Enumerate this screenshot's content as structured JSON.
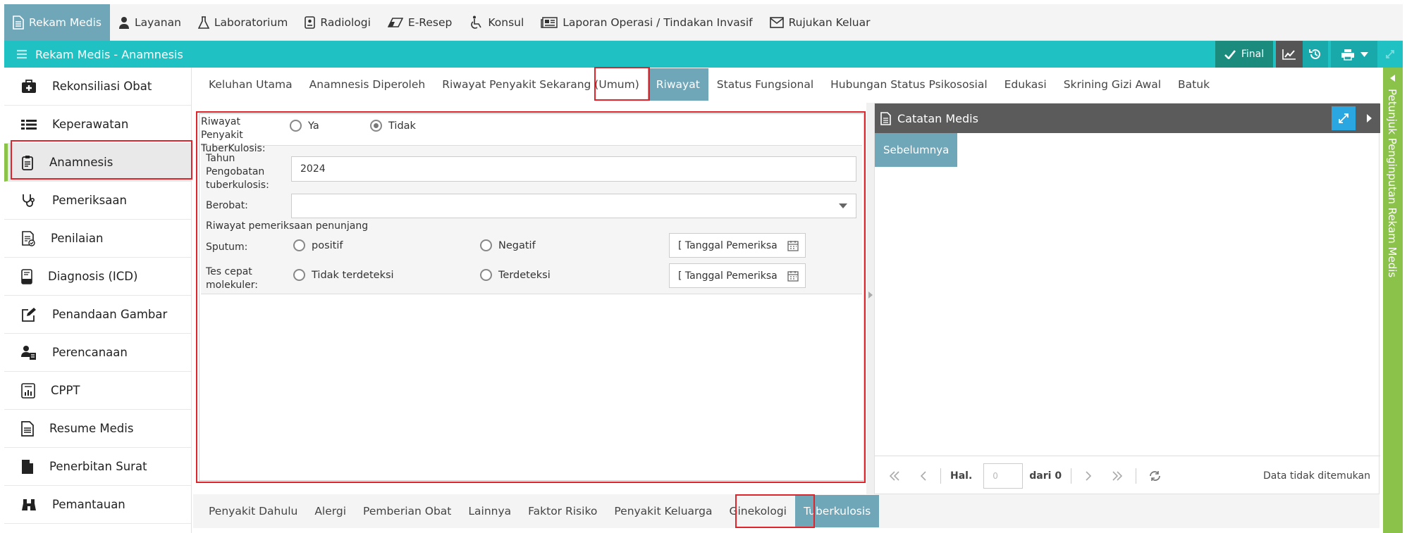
{
  "top_nav": [
    {
      "label": "Rekam Medis",
      "icon": "document-icon",
      "active": true
    },
    {
      "label": "Layanan",
      "icon": "doctor-icon"
    },
    {
      "label": "Laboratorium",
      "icon": "flask-icon"
    },
    {
      "label": "Radiologi",
      "icon": "xray-icon"
    },
    {
      "label": "E-Resep",
      "icon": "eraser-icon"
    },
    {
      "label": "Konsul",
      "icon": "wheelchair-icon"
    },
    {
      "label": "Laporan Operasi / Tindakan Invasif",
      "icon": "newspaper-icon"
    },
    {
      "label": "Rujukan Keluar",
      "icon": "envelope-icon"
    }
  ],
  "header": {
    "title": "Rekam Medis - Anamnesis",
    "final_label": "Final"
  },
  "sidebar": [
    {
      "label": "Rekonsiliasi Obat",
      "icon": "medkit-icon"
    },
    {
      "label": "Keperawatan",
      "icon": "list-icon"
    },
    {
      "label": "Anamnesis",
      "icon": "clipboard-icon",
      "active": true
    },
    {
      "label": "Pemeriksaan",
      "icon": "stethoscope-icon"
    },
    {
      "label": "Penilaian",
      "icon": "checklist-icon"
    },
    {
      "label": "Diagnosis (ICD)",
      "icon": "phone-doc-icon"
    },
    {
      "label": "Penandaan Gambar",
      "icon": "edit-icon"
    },
    {
      "label": "Perencanaan",
      "icon": "user-plan-icon"
    },
    {
      "label": "CPPT",
      "icon": "chart-doc-icon"
    },
    {
      "label": "Resume Medis",
      "icon": "file-text-icon"
    },
    {
      "label": "Penerbitan Surat",
      "icon": "file-icon"
    },
    {
      "label": "Pemantauan",
      "icon": "binoculars-icon"
    }
  ],
  "tabs": [
    "Keluhan Utama",
    "Anamnesis Diperoleh",
    "Riwayat Penyakit Sekarang (Umum)",
    "Riwayat",
    "Status Fungsional",
    "Hubungan Status Psikososial",
    "Edukasi",
    "Skrining Gizi Awal",
    "Batuk"
  ],
  "active_tab": "Riwayat",
  "form": {
    "riwayat_label": "Riwayat Penyakit TuberKulosis:",
    "opt_ya": "Ya",
    "opt_tidak": "Tidak",
    "selected": "Tidak",
    "tahun_label": "Tahun Pengobatan tuberkulosis:",
    "tahun_value": "2024",
    "berobat_label": "Berobat:",
    "berobat_value": "",
    "penunjang_label": "Riwayat pemeriksaan penunjang",
    "sputum_label": "Sputum:",
    "sputum_opt1": "positif",
    "sputum_opt2": "Negatif",
    "date_placeholder": "[ Tanggal Pemeriksa",
    "tcm_label": "Tes cepat molekuler:",
    "tcm_opt1": "Tidak terdeteksi",
    "tcm_opt2": "Terdeteksi"
  },
  "right_panel": {
    "title": "Catatan Medis",
    "tab": "Sebelumnya",
    "hal_label": "Hal.",
    "page_value": "0",
    "dari_label": "dari 0",
    "empty_label": "Data tidak ditemukan"
  },
  "bottom_tabs": [
    "Penyakit Dahulu",
    "Alergi",
    "Pemberian Obat",
    "Lainnya",
    "Faktor Risiko",
    "Penyakit Keluarga",
    "Ginekologi",
    "Tuberkulosis"
  ],
  "active_bottom_tab": "Tuberkulosis",
  "side_handle": "Petunjuk Penginputan Rekam Medis",
  "colors": {
    "teal": "#1fc1c3",
    "active_tab": "#6fa6b8",
    "green": "#8bc34a",
    "red_highlight": "#e0242b"
  }
}
